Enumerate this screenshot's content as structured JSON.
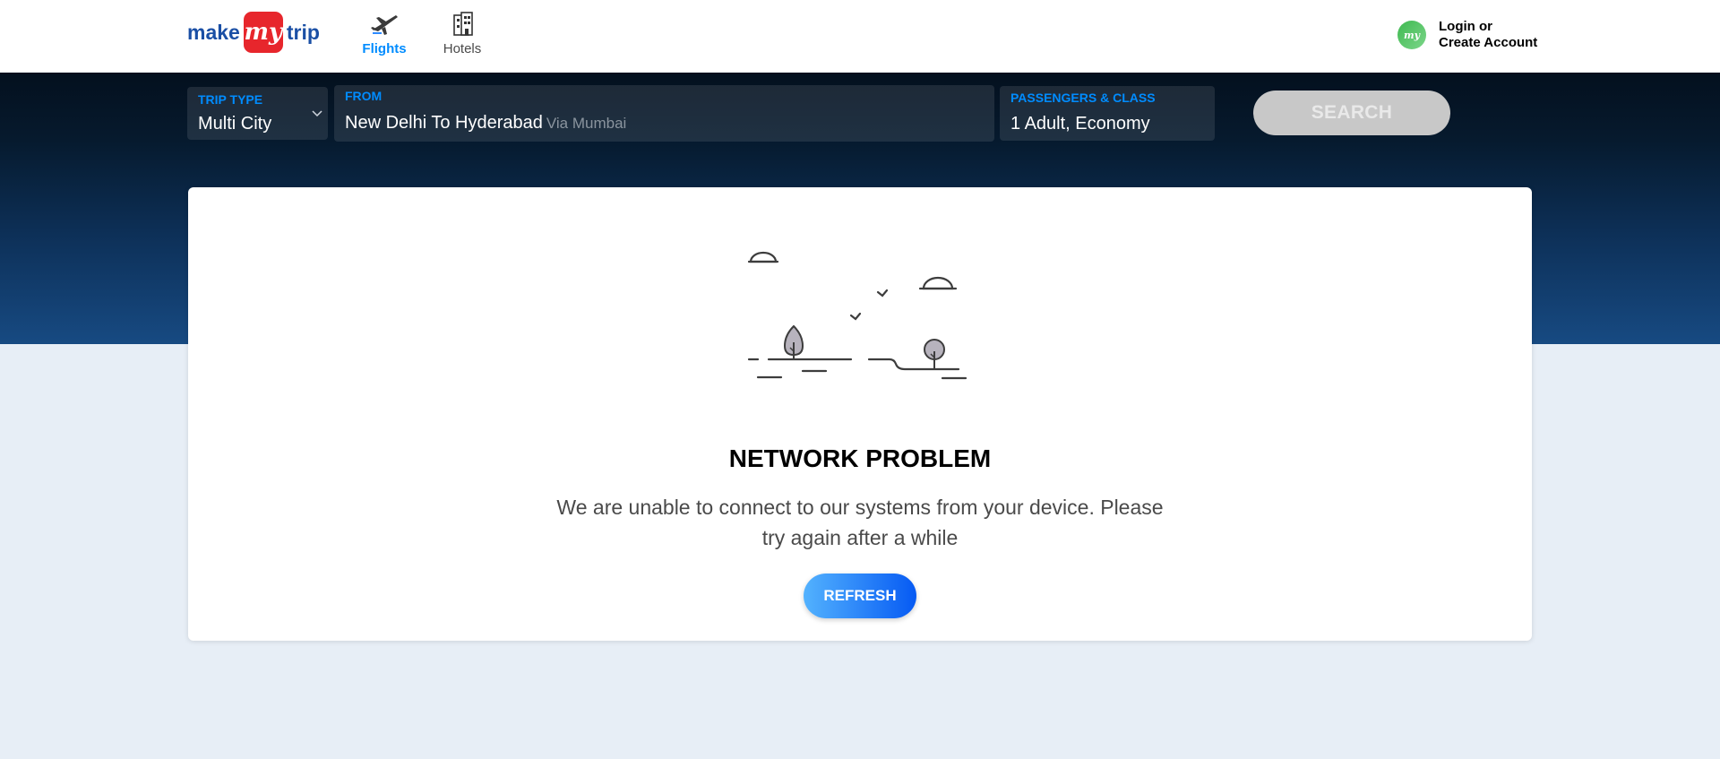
{
  "header": {
    "logo": {
      "make": "make",
      "my": "my",
      "trip": "trip"
    },
    "tabs": [
      {
        "label": "Flights",
        "icon": "airplane-icon",
        "active": true
      },
      {
        "label": "Hotels",
        "icon": "hotel-building-icon",
        "active": false
      }
    ],
    "login": {
      "avatar_text": "my",
      "line1": "Login or",
      "line2": "Create Account"
    }
  },
  "search": {
    "trip_type": {
      "label": "TRIP TYPE",
      "value": "Multi City"
    },
    "from": {
      "label": "FROM",
      "value": "New Delhi To Hyderabad",
      "via": "Via Mumbai"
    },
    "passengers": {
      "label": "PASSENGERS & CLASS",
      "value": "1 Adult, Economy"
    },
    "search_button": "SEARCH"
  },
  "error": {
    "title": "NETWORK PROBLEM",
    "message": "We are unable to connect to our systems from your device. Please try again after a while",
    "refresh_button": "REFRESH"
  },
  "colors": {
    "accent_blue": "#008cff",
    "logo_red": "#e7262c",
    "logo_blue": "#1a4fa5",
    "page_bg": "#e7eef6",
    "search_disabled": "#c8c8c8"
  }
}
